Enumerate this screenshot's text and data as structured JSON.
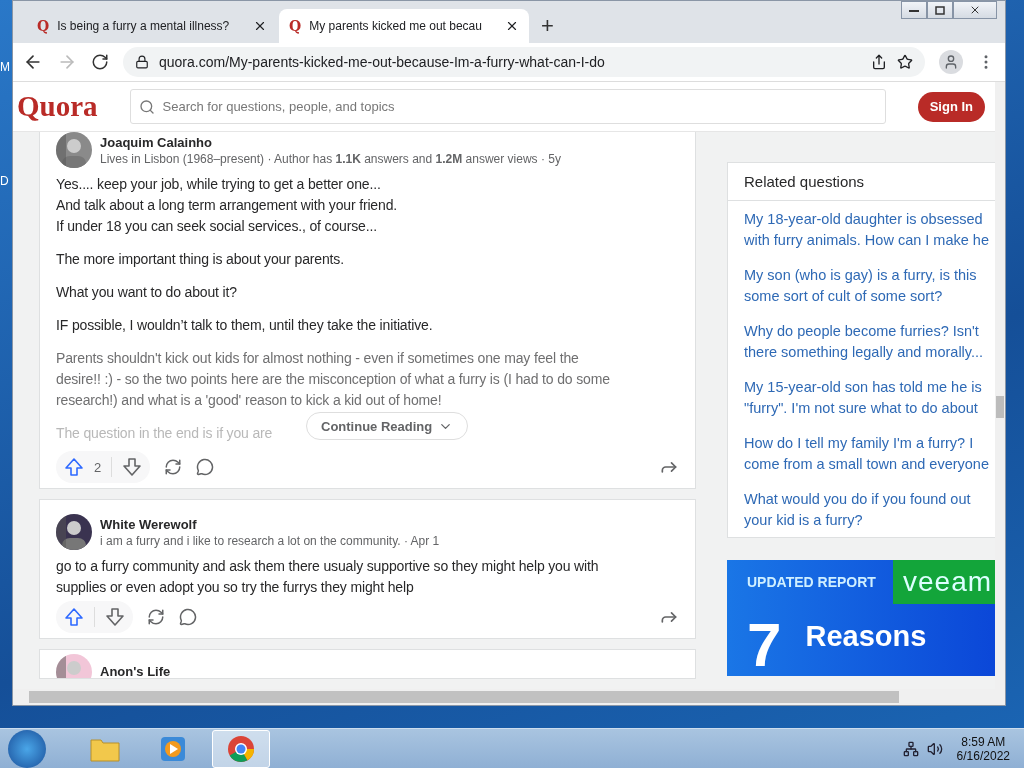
{
  "desktop_labels": [
    "M",
    "D"
  ],
  "browser": {
    "tabs": [
      {
        "icon": "Q",
        "title": "Is being a furry a mental illness?",
        "selected": false
      },
      {
        "icon": "Q",
        "title": "My parents kicked me out becau",
        "selected": true
      }
    ],
    "new_tab": "+",
    "address": "quora.com/My-parents-kicked-me-out-because-Im-a-furry-what-can-I-do"
  },
  "header": {
    "logo": "Quora",
    "search_placeholder": "Search for questions, people, and topics",
    "sign_in": "Sign In"
  },
  "answers": [
    {
      "author": "Joaquim Calainho",
      "credential": "Lives in Lisbon (1968–present) · Author has **1.1K** answers and **1.2M** answer views · 5y",
      "paragraphs": [
        [
          "Yes.... keep your job, while trying to get a better one...",
          "And talk about a long term arrangement with your friend.",
          "If under 18 you can seek social services., of course..."
        ],
        [
          "The more important thing is about your parents."
        ],
        [
          "What you want to do about it?"
        ],
        [
          "IF possible, I wouldn’t talk to them, until they take the initiative."
        ],
        [
          "Parents shouldn't kick out kids for almost nothing - even if sometimes one may feel the",
          "desire!! :) - so the two points here are the misconception of what a furry is (I had to do some",
          "research!) and what is a 'good' reason to kick a kid out of home!"
        ],
        [
          "The question in the end is if you are"
        ]
      ],
      "truncated": true,
      "continue": "Continue Reading",
      "upvotes": "2"
    },
    {
      "author": "White Werewolf",
      "credential": "i am a furry and i like to research a lot on the community. · Apr 1",
      "paragraphs": [
        [
          "go to a furry community and ask them there usualy supportive so they might help you with",
          "supplies or even adopt you so try the furrys they might help"
        ]
      ],
      "truncated": false
    },
    {
      "author": "Anon's Life",
      "cut": true
    }
  ],
  "related": {
    "title": "Related questions",
    "items": [
      {
        "lines": [
          "My 18-year-old daughter is obsessed",
          "with furry animals. How can I make he"
        ]
      },
      {
        "lines": [
          "My son (who is gay) is a furry, is this",
          "some sort of cult of some sort?"
        ]
      },
      {
        "lines": [
          "Why do people become furries? Isn't",
          "there something legally and morally..."
        ]
      },
      {
        "lines": [
          "My 15-year-old son has told me he is",
          "\"furry\". I'm not sure what to do about"
        ]
      },
      {
        "lines": [
          "How do I tell my family I'm a furry? I",
          "come from a small town and everyone"
        ]
      },
      {
        "lines": [
          "What would you do if you found out",
          "your kid is a furry?"
        ]
      }
    ]
  },
  "ad": {
    "tag": "UPDATED REPORT",
    "brand": "veeam",
    "number": "7",
    "headline": "Reasons"
  },
  "taskbar": {
    "time": "8:59 AM",
    "date": "6/16/2022"
  }
}
